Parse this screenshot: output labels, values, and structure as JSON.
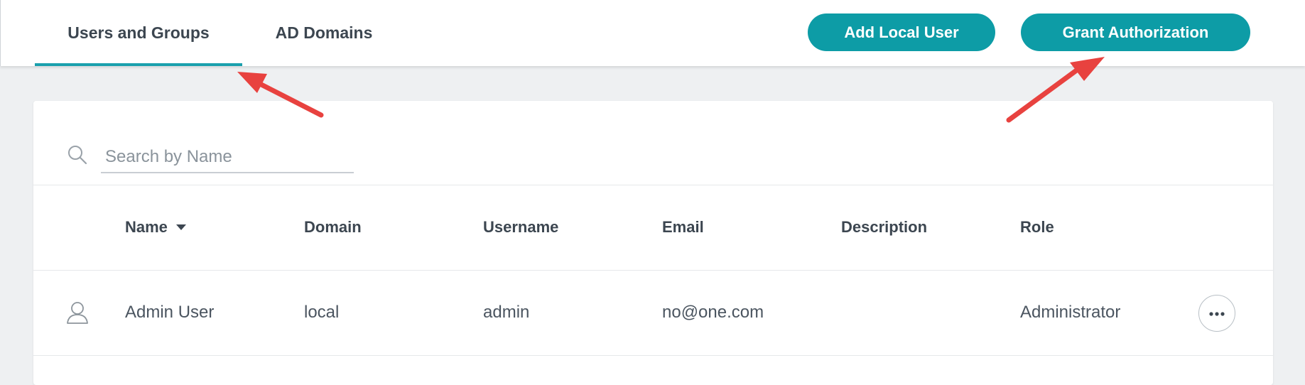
{
  "tabs": [
    {
      "label": "Users and Groups",
      "active": true
    },
    {
      "label": "AD Domains",
      "active": false
    }
  ],
  "actions": {
    "add_local_user": "Add Local User",
    "grant_authorization": "Grant Authorization"
  },
  "search": {
    "placeholder": "Search by Name",
    "value": ""
  },
  "table": {
    "columns": [
      "Name",
      "Domain",
      "Username",
      "Email",
      "Description",
      "Role"
    ],
    "sorted_column": "Name",
    "rows": [
      {
        "name": "Admin User",
        "domain": "local",
        "username": "admin",
        "email": "no@one.com",
        "description": "",
        "role": "Administrator"
      }
    ]
  },
  "colors": {
    "accent": "#0d9ca6",
    "annotation_arrow": "#e8423f"
  },
  "icons": [
    "search-icon",
    "user-icon",
    "more-options-icon",
    "sort-caret-down-icon"
  ]
}
